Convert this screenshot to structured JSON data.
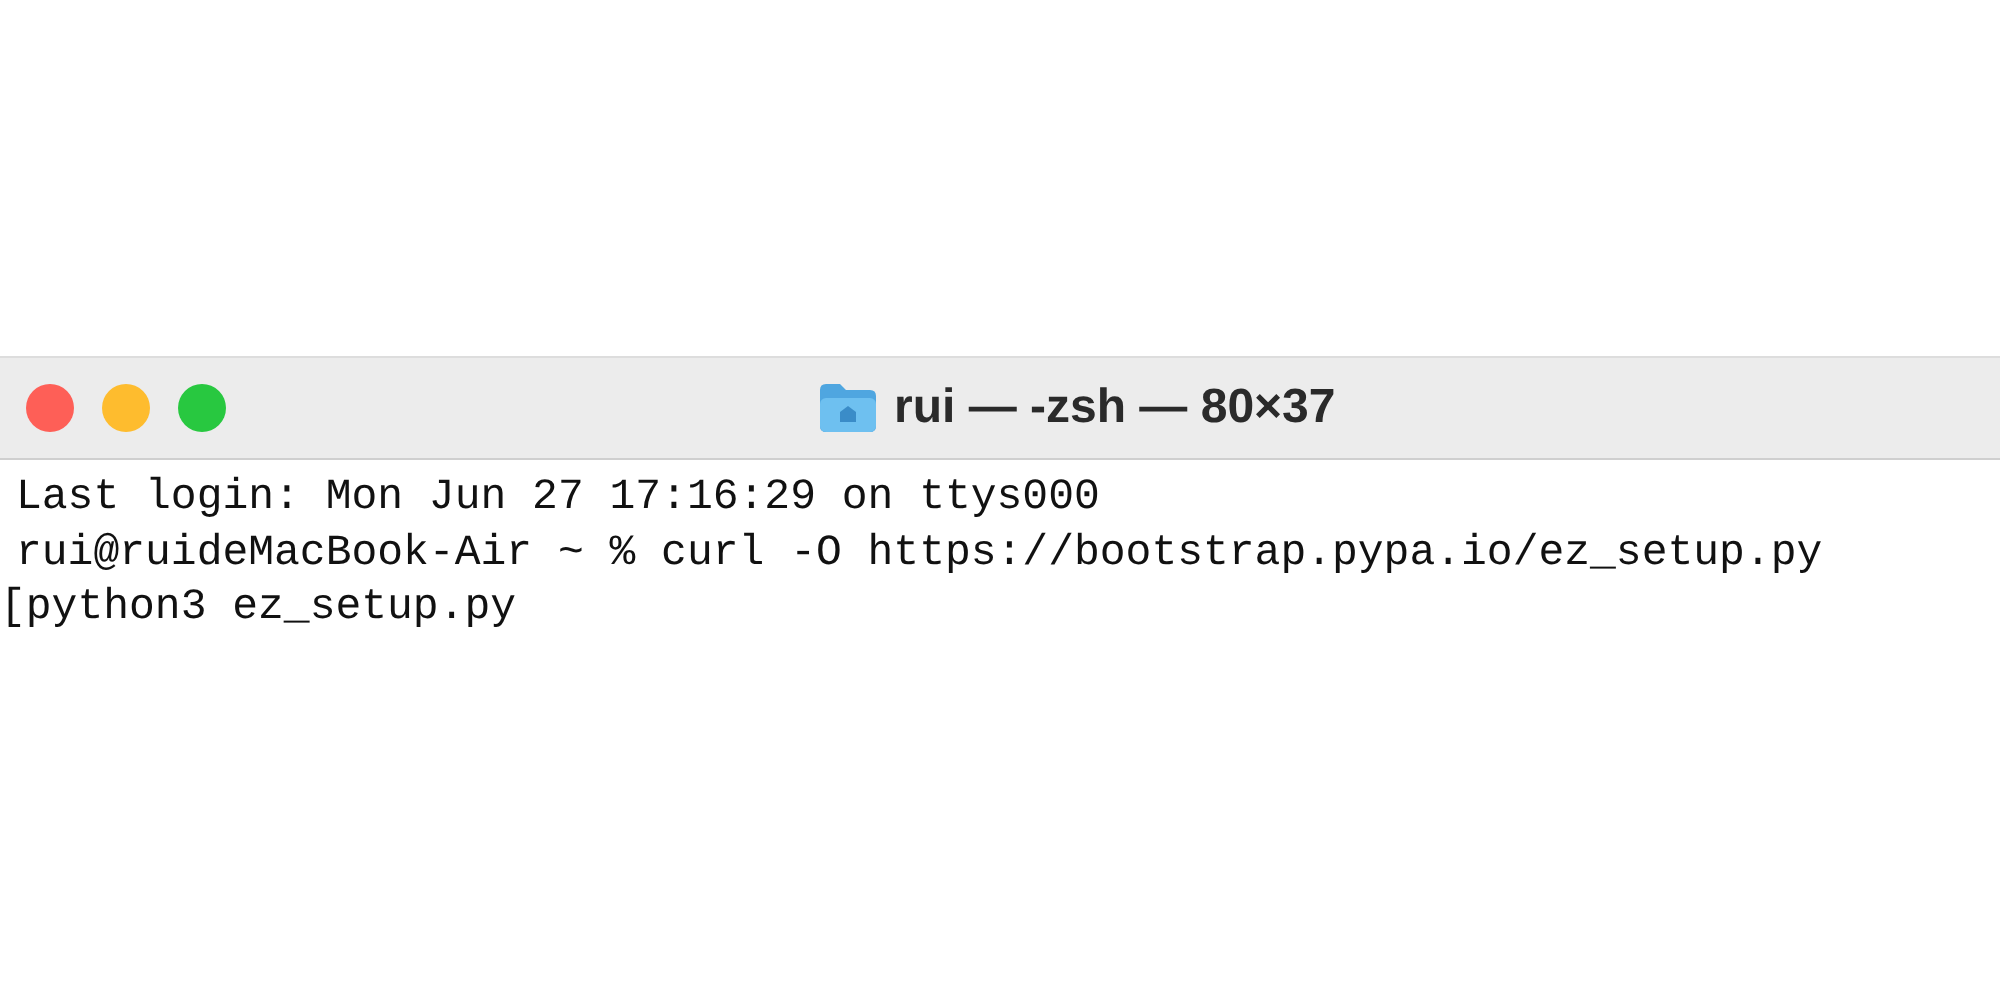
{
  "window": {
    "title": "rui — -zsh — 80×37"
  },
  "terminal": {
    "lines": [
      {
        "text": "Last login: Mon Jun 27 17:16:29 on ttys000"
      },
      {
        "text": "rui@ruideMacBook-Air ~ % curl -O https://bootstrap.pypa.io/ez_setup.py"
      },
      {
        "text": "[python3 ez_setup.py"
      }
    ]
  }
}
